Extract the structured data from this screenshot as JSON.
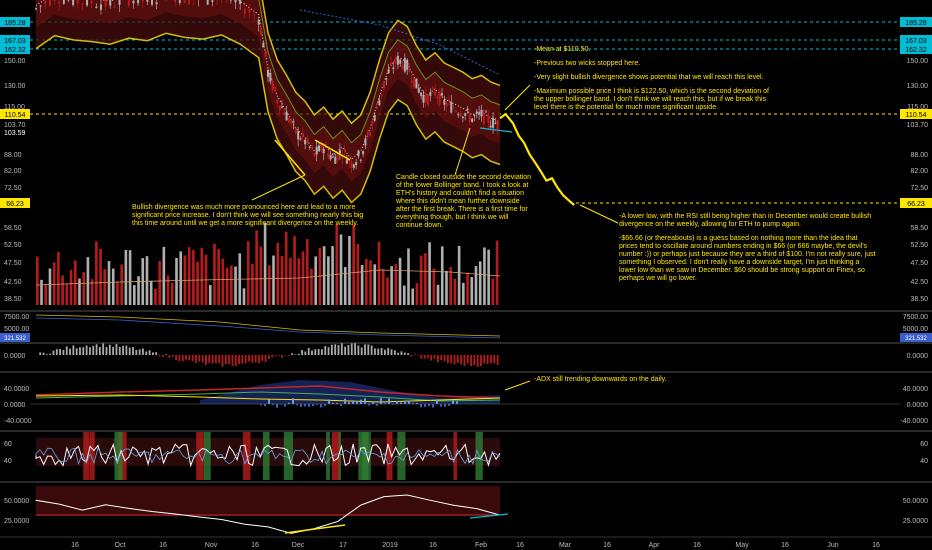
{
  "chart_data": {
    "type": "line",
    "panes": [
      {
        "id": "price",
        "kind": "price",
        "ticks": [
          150.0,
          130.0,
          115.0,
          103.7,
          88.0,
          82.0,
          72.5,
          58.5,
          52.5,
          47.5,
          42.5,
          38.5
        ],
        "ticks_left": [
          150.0,
          130.0,
          115.0,
          103.7,
          88.0,
          82.0,
          72.5,
          58.5,
          52.5,
          47.5,
          42.5,
          38.5
        ],
        "price_tags": [
          {
            "value": "185.28",
            "color": "#00bcd4"
          },
          {
            "value": "167.03",
            "color": "#00bcd4"
          },
          {
            "value": "162.32",
            "color": "#00bcd4"
          },
          {
            "value": "110.54",
            "color": "#ffe600"
          },
          {
            "value": "66.23",
            "color": "#ffe600"
          }
        ],
        "extra_left": [
          "103.59"
        ]
      },
      {
        "id": "volume",
        "kind": "volume",
        "ticks": [
          7500.0,
          5000.0
        ]
      },
      {
        "id": "macd",
        "kind": "histogram",
        "ticks": [
          0.0
        ],
        "tag": "321.532"
      },
      {
        "id": "adx",
        "kind": "adx",
        "ticks": [
          40.0,
          0.0,
          -40.0
        ]
      },
      {
        "id": "rsi",
        "kind": "oscillator",
        "ticks": [
          60,
          40
        ]
      },
      {
        "id": "stoch",
        "kind": "oscillator",
        "ticks": [
          50.0,
          25.0
        ]
      }
    ],
    "x_ticks": [
      {
        "label": "16",
        "x": 75
      },
      {
        "label": "Oct",
        "x": 120
      },
      {
        "label": "16",
        "x": 163
      },
      {
        "label": "Nov",
        "x": 211
      },
      {
        "label": "16",
        "x": 255
      },
      {
        "label": "Dec",
        "x": 298
      },
      {
        "label": "17",
        "x": 343
      },
      {
        "label": "2019",
        "x": 390
      },
      {
        "label": "16",
        "x": 433
      },
      {
        "label": "Feb",
        "x": 481
      },
      {
        "label": "16",
        "x": 520
      },
      {
        "label": "Mar",
        "x": 565
      },
      {
        "label": "16",
        "x": 607
      },
      {
        "label": "Apr",
        "x": 654
      },
      {
        "label": "16",
        "x": 697
      },
      {
        "label": "May",
        "x": 742
      },
      {
        "label": "16",
        "x": 785
      },
      {
        "label": "Jun",
        "x": 833
      },
      {
        "label": "16",
        "x": 876
      }
    ],
    "price_path": [
      {
        "t": 0,
        "p": 200
      },
      {
        "t": 10,
        "p": 215
      },
      {
        "t": 20,
        "p": 210
      },
      {
        "t": 30,
        "p": 208
      },
      {
        "t": 40,
        "p": 205
      },
      {
        "t": 50,
        "p": 212
      },
      {
        "t": 60,
        "p": 209
      },
      {
        "t": 70,
        "p": 218
      },
      {
        "t": 80,
        "p": 213
      },
      {
        "t": 90,
        "p": 211
      },
      {
        "t": 100,
        "p": 216
      },
      {
        "t": 110,
        "p": 205
      },
      {
        "t": 120,
        "p": 190
      },
      {
        "t": 125,
        "p": 140
      },
      {
        "t": 130,
        "p": 120
      },
      {
        "t": 135,
        "p": 110
      },
      {
        "t": 140,
        "p": 100
      },
      {
        "t": 145,
        "p": 95
      },
      {
        "t": 150,
        "p": 88
      },
      {
        "t": 155,
        "p": 92
      },
      {
        "t": 160,
        "p": 86
      },
      {
        "t": 165,
        "p": 90
      },
      {
        "t": 170,
        "p": 84
      },
      {
        "t": 175,
        "p": 88
      },
      {
        "t": 180,
        "p": 100
      },
      {
        "t": 185,
        "p": 120
      },
      {
        "t": 190,
        "p": 140
      },
      {
        "t": 195,
        "p": 150
      },
      {
        "t": 200,
        "p": 145
      },
      {
        "t": 205,
        "p": 130
      },
      {
        "t": 210,
        "p": 120
      },
      {
        "t": 215,
        "p": 125
      },
      {
        "t": 220,
        "p": 118
      },
      {
        "t": 225,
        "p": 115
      },
      {
        "t": 230,
        "p": 112
      },
      {
        "t": 235,
        "p": 108
      },
      {
        "t": 240,
        "p": 110
      },
      {
        "t": 245,
        "p": 106
      },
      {
        "t": 250,
        "p": 104
      }
    ],
    "forecast": [
      {
        "t": 250,
        "p": 108
      },
      {
        "t": 253,
        "p": 110.54
      },
      {
        "t": 257,
        "p": 105
      },
      {
        "t": 260,
        "p": 98
      },
      {
        "t": 263,
        "p": 94
      },
      {
        "t": 266,
        "p": 88
      },
      {
        "t": 269,
        "p": 84
      },
      {
        "t": 272,
        "p": 80
      },
      {
        "t": 275,
        "p": 76
      },
      {
        "t": 278,
        "p": 77
      },
      {
        "t": 281,
        "p": 73
      },
      {
        "t": 284,
        "p": 70
      },
      {
        "t": 287,
        "p": 68
      },
      {
        "t": 290,
        "p": 66.23
      }
    ],
    "annotations": [
      {
        "id": "mean",
        "text": "-Mean at $110.50."
      },
      {
        "id": "wicks",
        "text": "-Previous two wicks stopped here."
      },
      {
        "id": "div",
        "text": "-Very slight bullish divergence shows potential that we will reach this level."
      },
      {
        "id": "max",
        "text": "-Maximum possible price I think is $122.50, which is the second deviation of\nthe upper bollinger band. I don't think we will reach this, but if we break this\nlevel there is the potential for much more significant upside."
      },
      {
        "id": "candle",
        "text": "Candle closed outside the second deviation\nof the lower Bollinger band. I took a look at\nETH's history and couldn't find a situation\nwhere this didn't mean further downside\nafter the first break. There is a first time for\neverything though, but I think we will\ncontinue down."
      },
      {
        "id": "bullish",
        "text": "Bullish divergence was much more pronounced here and lead to a more\nsignificant price increase. I don't think we will see something nearly this big\nthis time around until we get a more significant divergence on the weekly."
      },
      {
        "id": "lowlow",
        "text": "-A lower low, with the RSI still being higher than in December would create bullish\ndivergence on the weekly, allowing for ETH to pump again."
      },
      {
        "id": "sixty",
        "text": "-$66.66 (or thereabouts) is a guess based on nothing more than the idea that\nprices tend to oscillate around numbers ending in $66 (or 666 maybe, the devil's\nnumber :)) or perhaps just because they are a third of $100. I'm not really sure, just\nsomething I observed. I don't really have a downside target, I'm just thinking a\nlower low than we saw in December. $60 should be strong support on Finex, so\nperhaps we will go lower."
      },
      {
        "id": "adx",
        "text": "-ADX still trending downwards on the daily."
      }
    ],
    "colors": {
      "bull": "#b0b0b0",
      "bear": "#b71c1c",
      "annotation": "#ffe600",
      "cyan": "#00bcd4"
    }
  }
}
